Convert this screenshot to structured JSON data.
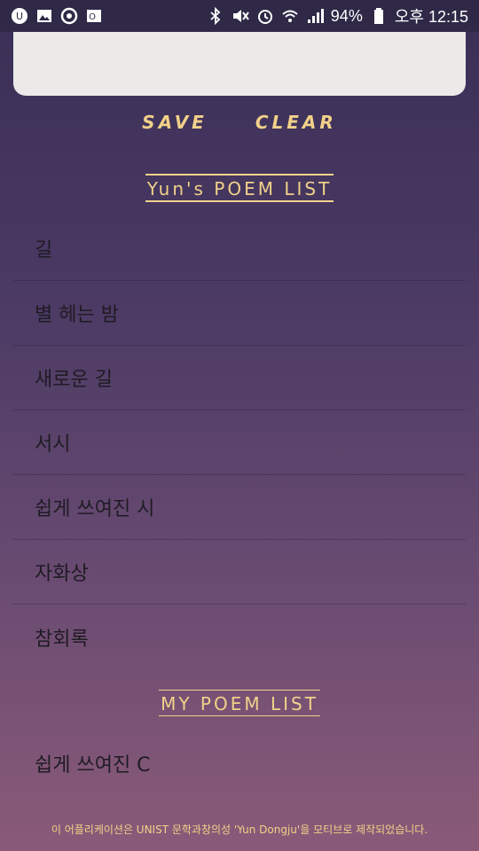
{
  "status_bar": {
    "left_icons": [
      "u-app-icon",
      "gallery-icon",
      "sync-app-icon",
      "outlook-icon"
    ],
    "right_icons": [
      "bluetooth-icon",
      "mute-icon",
      "alarm-icon",
      "wifi-icon",
      "signal-icon",
      "battery-icon"
    ],
    "battery": "94%",
    "time": "오후 12:15"
  },
  "actions": {
    "save_label": "SAVE",
    "clear_label": "CLEAR"
  },
  "yun_list": {
    "title": "Yun's POEM LIST",
    "items": [
      "길",
      "별 헤는 밤",
      "새로운 길",
      "서시",
      "쉽게 쓰여진 시",
      "자화상",
      "참회록"
    ]
  },
  "my_list": {
    "title": "MY POEM LIST",
    "items": [
      "쉽게 쓰여진 C"
    ]
  },
  "footer": "이 어플리케이션은 UNIST 문학과창의성 'Yun Dongju'을 모티브로 제작되었습니다.",
  "colors": {
    "accent": "#f1d189",
    "text_area": "#ebeae8",
    "status_bar": "#2f2947"
  }
}
